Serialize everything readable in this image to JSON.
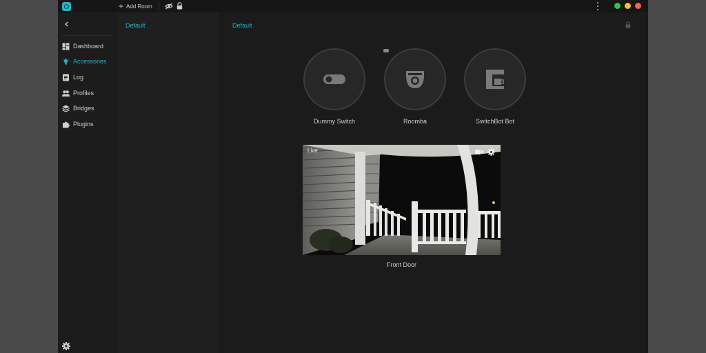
{
  "topbar": {
    "add_room_label": "Add Room"
  },
  "sidebar": {
    "items": [
      {
        "label": "Dashboard",
        "icon": "dashboard-icon"
      },
      {
        "label": "Accessories",
        "icon": "lightbulb-icon",
        "active": true
      },
      {
        "label": "Log",
        "icon": "log-icon"
      },
      {
        "label": "Profiles",
        "icon": "users-icon"
      },
      {
        "label": "Bridges",
        "icon": "layers-icon"
      },
      {
        "label": "Plugins",
        "icon": "puzzle-icon"
      }
    ]
  },
  "rooms": {
    "items": [
      {
        "label": "Default"
      }
    ]
  },
  "main": {
    "title": "Default",
    "accessories": [
      {
        "label": "Dummy Switch",
        "icon": "switch-icon"
      },
      {
        "label": "Roomba",
        "icon": "robot-vacuum-icon"
      },
      {
        "label": "SwitchBot Bot",
        "icon": "coffee-machine-icon"
      }
    ],
    "camera": {
      "live_label": "Live",
      "label": "Front Door"
    }
  },
  "colors": {
    "accent": "#1eb5c8",
    "background": "#1a1a1a",
    "window_green": "#28c840",
    "window_yellow": "#febc2e",
    "window_red": "#ff5f57"
  }
}
